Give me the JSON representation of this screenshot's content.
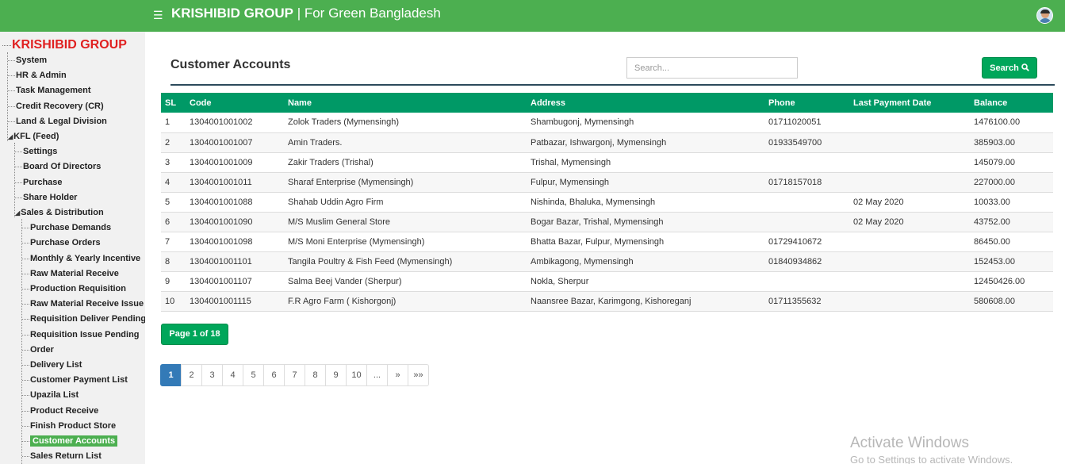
{
  "header": {
    "menu_icon": "hamburger-icon",
    "brand_bold": "KRISHIBID GROUP",
    "brand_sep": " | ",
    "brand_tagline": "For Green Bangladesh",
    "avatar_icon": "user-avatar-icon"
  },
  "sidebar": {
    "root": "KRISHIBID GROUP",
    "top_items": [
      "System",
      "HR & Admin",
      "Task Management",
      "Credit Recovery (CR)",
      "Land & Legal Division",
      "KFL (Feed)"
    ],
    "kfl_items": [
      "Settings",
      "Board Of Directors",
      "Purchase",
      "Share Holder",
      "Sales & Distribution"
    ],
    "sales_items": [
      "Purchase Demands",
      "Purchase Orders",
      "Monthly & Yearly Incentive",
      "Raw Material Receive",
      "Production Requisition",
      "Raw Material Receive Issue",
      "Requisition Deliver Pending",
      "Requisition Issue Pending",
      "Order",
      "Delivery List",
      "Customer Payment List",
      "Upazila List",
      "Product Receive",
      "Finish Product Store",
      "Customer Accounts",
      "Sales Return List"
    ],
    "active_item": "Customer Accounts"
  },
  "main": {
    "title": "Customer Accounts",
    "search_placeholder": "Search...",
    "search_button": "Search",
    "search_icon": "search-icon",
    "page_indicator": "Page 1 of 18"
  },
  "table": {
    "columns": [
      "SL",
      "Code",
      "Name",
      "Address",
      "Phone",
      "Last Payment Date",
      "Balance"
    ],
    "rows": [
      [
        "1",
        "1304001001002",
        "Zolok Traders (Mymensingh)",
        "Shambugonj, Mymensingh",
        "01711020051",
        "",
        "1476100.00"
      ],
      [
        "2",
        "1304001001007",
        "Amin Traders.",
        "Patbazar, Ishwargonj, Mymensingh",
        "01933549700",
        "",
        "385903.00"
      ],
      [
        "3",
        "1304001001009",
        "Zakir Traders (Trishal)",
        "Trishal, Mymensingh",
        "",
        "",
        "145079.00"
      ],
      [
        "4",
        "1304001001011",
        "Sharaf Enterprise (Mymensingh)",
        "Fulpur, Mymensingh",
        "01718157018",
        "",
        "227000.00"
      ],
      [
        "5",
        "1304001001088",
        "Shahab Uddin Agro Firm",
        "Nishinda, Bhaluka, Mymensingh",
        "",
        "02 May 2020",
        "10033.00"
      ],
      [
        "6",
        "1304001001090",
        "M/S Muslim General Store",
        "Bogar Bazar, Trishal, Mymensingh",
        "",
        "02 May 2020",
        "43752.00"
      ],
      [
        "7",
        "1304001001098",
        "M/S Moni Enterprise (Mymensingh)",
        "Bhatta Bazar, Fulpur, Mymensingh",
        "01729410672",
        "",
        "86450.00"
      ],
      [
        "8",
        "1304001001101",
        "Tangila Poultry & Fish Feed (Mymensingh)",
        "Ambikagong, Mymensingh",
        "01840934862",
        "",
        "152453.00"
      ],
      [
        "9",
        "1304001001107",
        "Salma Beej Vander (Sherpur)",
        "Nokla, Sherpur",
        "",
        "",
        "12450426.00"
      ],
      [
        "10",
        "1304001001115",
        "F.R Agro Farm ( Kishorgonj)",
        "Naansree Bazar, Karimgong, Kishoreganj",
        "01711355632",
        "",
        "580608.00"
      ]
    ]
  },
  "pagination": {
    "pages": [
      "1",
      "2",
      "3",
      "4",
      "5",
      "6",
      "7",
      "8",
      "9",
      "10",
      "...",
      "»",
      "»»"
    ],
    "current": "1"
  },
  "watermark": {
    "line1": "Activate Windows",
    "line2": "Go to Settings to activate Windows."
  }
}
